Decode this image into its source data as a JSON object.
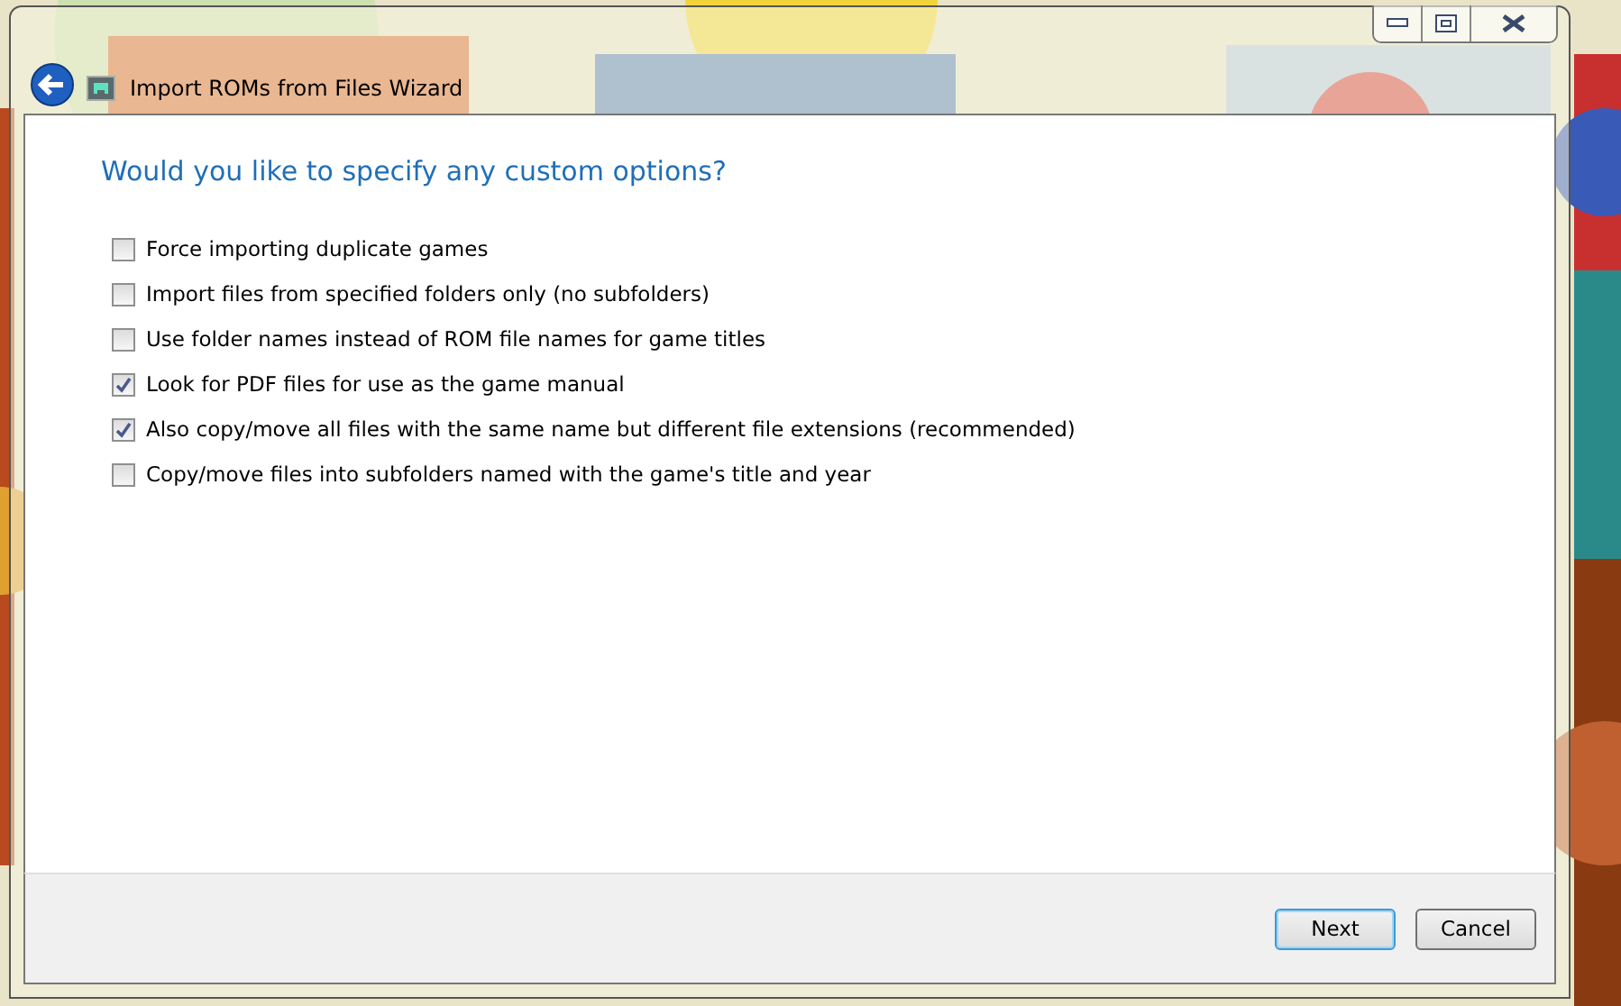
{
  "window": {
    "title": "Import ROMs from Files Wizard"
  },
  "heading": "Would you like to specify any custom options?",
  "options": [
    {
      "label": "Force importing duplicate games",
      "checked": false
    },
    {
      "label": "Import files from specified folders only (no subfolders)",
      "checked": false
    },
    {
      "label": "Use folder names instead of ROM file names for game titles",
      "checked": false
    },
    {
      "label": "Look for PDF files for use as the game manual",
      "checked": true
    },
    {
      "label": "Also copy/move all files with the same name but different file extensions (recommended)",
      "checked": true
    },
    {
      "label": "Copy/move files into subfolders named with the game's title and year",
      "checked": false
    }
  ],
  "buttons": [
    {
      "label": "Next",
      "default": true
    },
    {
      "label": "Cancel",
      "default": false
    }
  ]
}
